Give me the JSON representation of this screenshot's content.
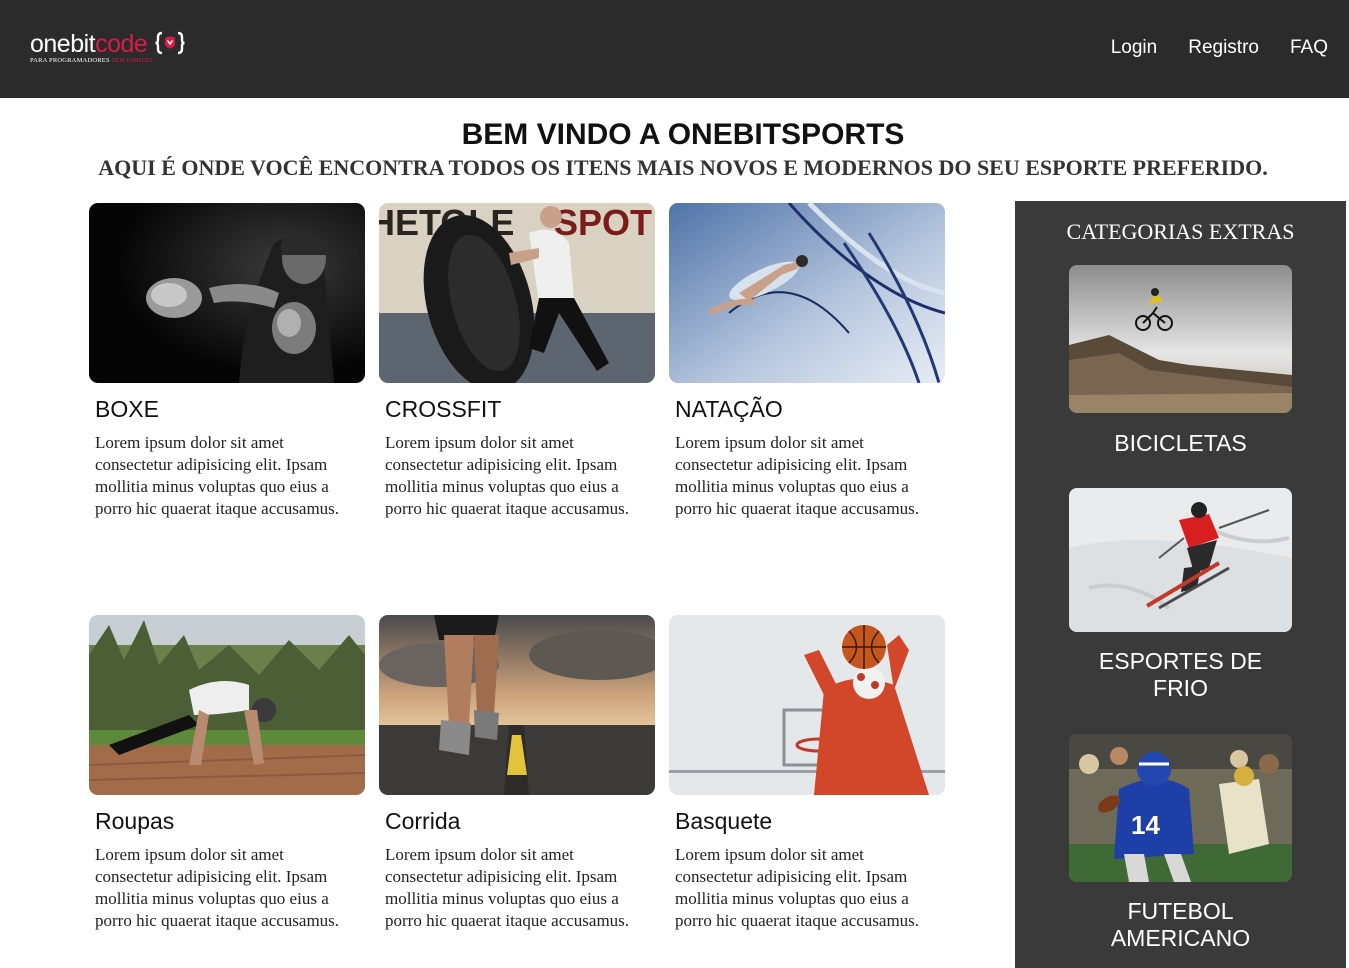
{
  "header": {
    "logo": {
      "part_one": "onebit",
      "part_code": "code",
      "brace": "{ }",
      "tagline": "PARA PROGRAMADORES",
      "tagline_accent": "SEM LIMITES"
    },
    "nav": [
      {
        "label": "Login"
      },
      {
        "label": "Registro"
      },
      {
        "label": "FAQ"
      }
    ]
  },
  "main": {
    "title": "BEM VINDO A ONEBITSPORTS",
    "subtitle": "AQUI É ONDE VOCÊ ENCONTRA TODOS OS ITENS MAIS NOVOS E MODERNOS DO SEU ESPORTE PREFERIDO.",
    "cards": [
      {
        "title": "BOXE",
        "text": "Lorem ipsum dolor sit amet consectetur adipisicing elit. Ipsam mollitia minus voluptas quo eius a porro hic quaerat itaque accusamus.",
        "image": "boxer-photo"
      },
      {
        "title": "CROSSFIT",
        "text": "Lorem ipsum dolor sit amet consectetur adipisicing elit. Ipsam mollitia minus voluptas quo eius a porro hic quaerat itaque accusamus.",
        "image": "tire-flip-photo"
      },
      {
        "title": "NATAÇÃO",
        "text": "Lorem ipsum dolor sit amet consectetur adipisicing elit. Ipsam mollitia minus voluptas quo eius a porro hic quaerat itaque accusamus.",
        "image": "swimmer-photo"
      },
      {
        "title": "Roupas",
        "text": "Lorem ipsum dolor sit amet consectetur adipisicing elit. Ipsam mollitia minus voluptas quo eius a porro hic quaerat itaque accusamus.",
        "image": "pushup-photo"
      },
      {
        "title": "Corrida",
        "text": "Lorem ipsum dolor sit amet consectetur adipisicing elit. Ipsam mollitia minus voluptas quo eius a porro hic quaerat itaque accusamus.",
        "image": "runner-photo"
      },
      {
        "title": "Basquete",
        "text": "Lorem ipsum dolor sit amet consectetur adipisicing elit. Ipsam mollitia minus voluptas quo eius a porro hic quaerat itaque accusamus.",
        "image": "basketball-photo"
      }
    ]
  },
  "sidebar": {
    "title": "CATEGORIAS EXTRAS",
    "items": [
      {
        "label": "BICICLETAS",
        "image": "bike-jump-photo"
      },
      {
        "label": "ESPORTES DE FRIO",
        "image": "skier-photo"
      },
      {
        "label": "FUTEBOL AMERICANO",
        "image": "football-photo"
      }
    ]
  }
}
